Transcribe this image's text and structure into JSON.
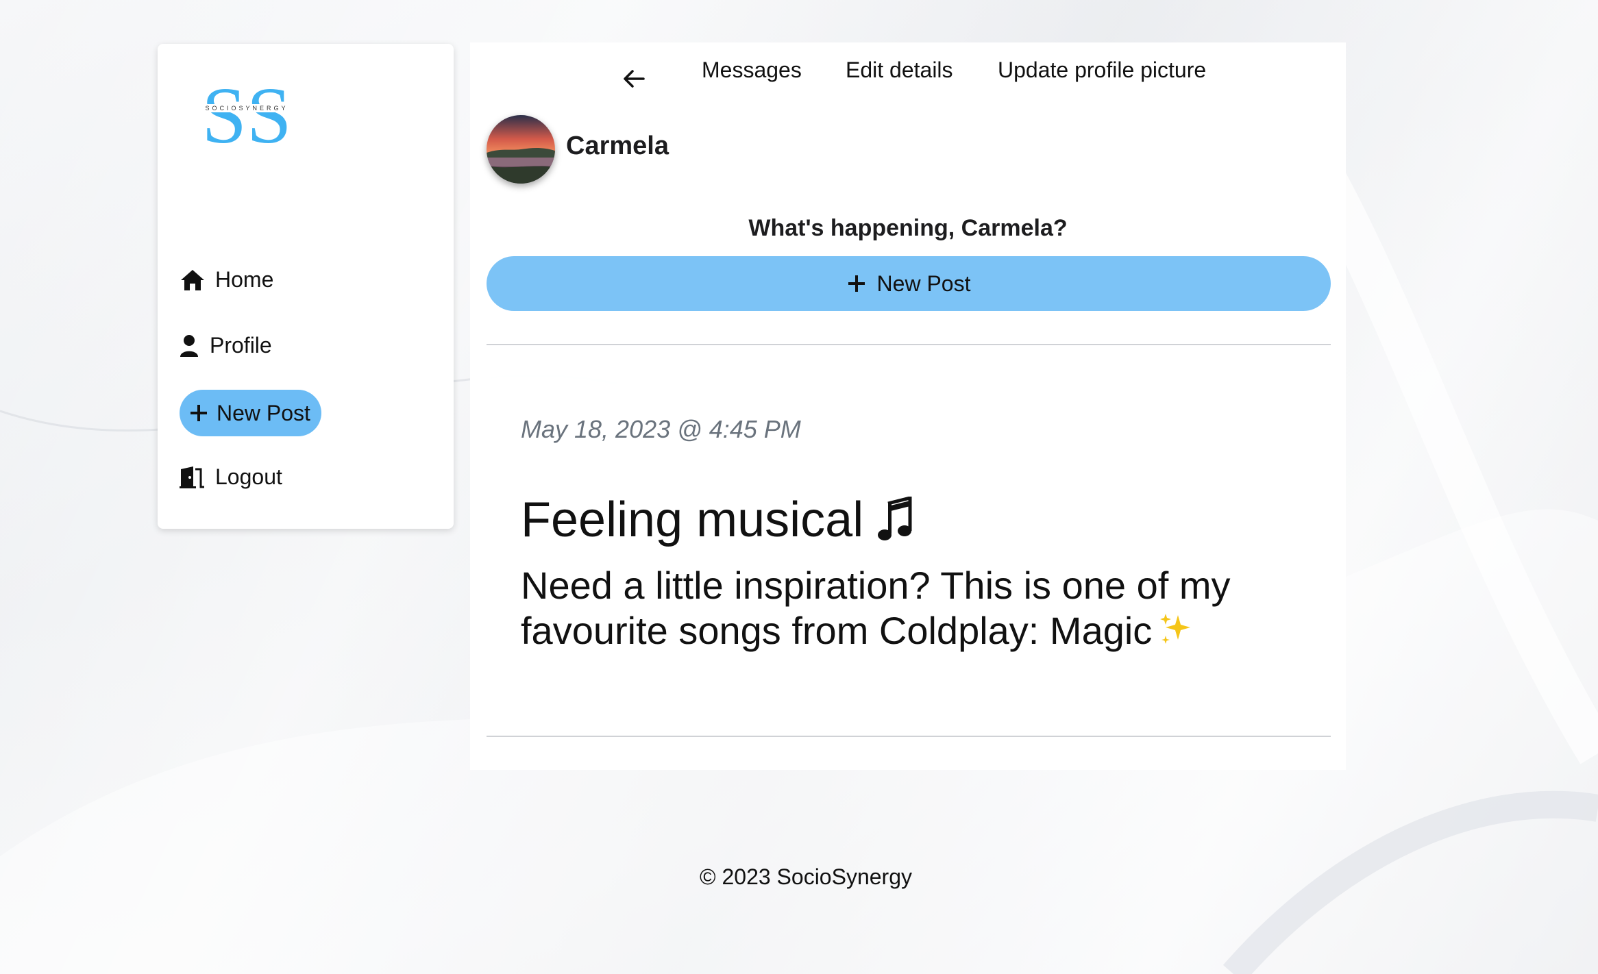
{
  "app": {
    "brand": "SOCIOSYNERGY",
    "brand_color": "#3fb2f2",
    "accent_color": "#7cc3f6"
  },
  "sidebar": {
    "items": [
      {
        "label": "Home",
        "icon": "home-icon"
      },
      {
        "label": "Profile",
        "icon": "user-icon"
      },
      {
        "label": "New Post",
        "icon": "plus-icon"
      },
      {
        "label": "Logout",
        "icon": "door-icon"
      }
    ]
  },
  "topnav": {
    "back_icon": "arrow-left-icon",
    "links": [
      "Messages",
      "Edit details",
      "Update profile picture"
    ]
  },
  "profile": {
    "name": "Carmela",
    "avatar_icon": "sunset-landscape-avatar"
  },
  "composer": {
    "prompt": "What's happening, Carmela?",
    "button_label": "New Post"
  },
  "post": {
    "date": "May 18, 2023 @ 4:45 PM",
    "title": "Feeling musical",
    "title_icon": "music-note-icon",
    "body": "Need a little inspiration? This is one of my favourite songs from Coldplay: Magic",
    "body_icon": "sparkles-icon"
  },
  "footer": {
    "text": "© 2023 SocioSynergy"
  }
}
